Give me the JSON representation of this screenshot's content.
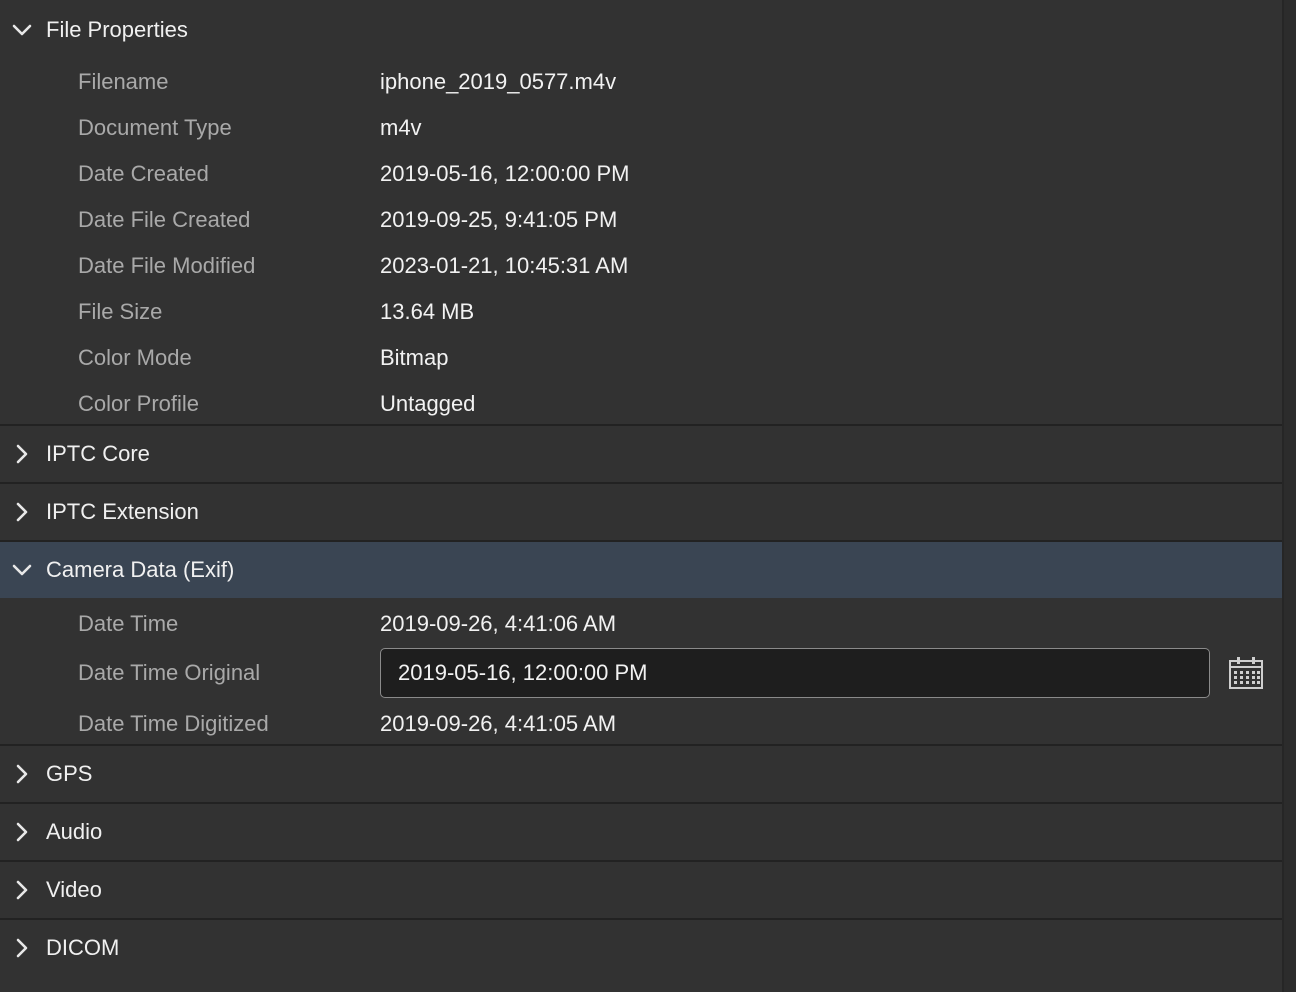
{
  "sections": {
    "file_properties": {
      "title": "File Properties",
      "expanded": true,
      "rows": [
        {
          "label": "Filename",
          "value": "iphone_2019_0577.m4v"
        },
        {
          "label": "Document Type",
          "value": "m4v"
        },
        {
          "label": "Date Created",
          "value": "2019-05-16, 12:00:00 PM"
        },
        {
          "label": "Date File Created",
          "value": "2019-09-25, 9:41:05 PM"
        },
        {
          "label": "Date File Modified",
          "value": "2023-01-21, 10:45:31 AM"
        },
        {
          "label": "File Size",
          "value": "13.64 MB"
        },
        {
          "label": "Color Mode",
          "value": "Bitmap"
        },
        {
          "label": "Color Profile",
          "value": "Untagged"
        }
      ]
    },
    "iptc_core": {
      "title": "IPTC Core",
      "expanded": false
    },
    "iptc_extension": {
      "title": "IPTC Extension",
      "expanded": false
    },
    "camera_data": {
      "title": "Camera Data (Exif)",
      "expanded": true,
      "rows": [
        {
          "label": "Date Time",
          "value": "2019-09-26, 4:41:06 AM"
        },
        {
          "label": "Date Time Original",
          "value": "2019-05-16, 12:00:00 PM"
        },
        {
          "label": "Date Time Digitized",
          "value": "2019-09-26, 4:41:05 AM"
        }
      ]
    },
    "gps": {
      "title": "GPS",
      "expanded": false
    },
    "audio": {
      "title": "Audio",
      "expanded": false
    },
    "video": {
      "title": "Video",
      "expanded": false
    },
    "dicom": {
      "title": "DICOM",
      "expanded": false
    }
  },
  "icons": {
    "expanded": "chevron-down-icon",
    "collapsed": "chevron-right-icon",
    "date_picker": "calendar-icon"
  },
  "colors": {
    "panel_background": "#323232",
    "active_header": "#3a4553",
    "label_text": "#a9a9a9",
    "value_text": "#f2f2f2",
    "input_background": "#1e1e1e",
    "divider": "#222222"
  }
}
